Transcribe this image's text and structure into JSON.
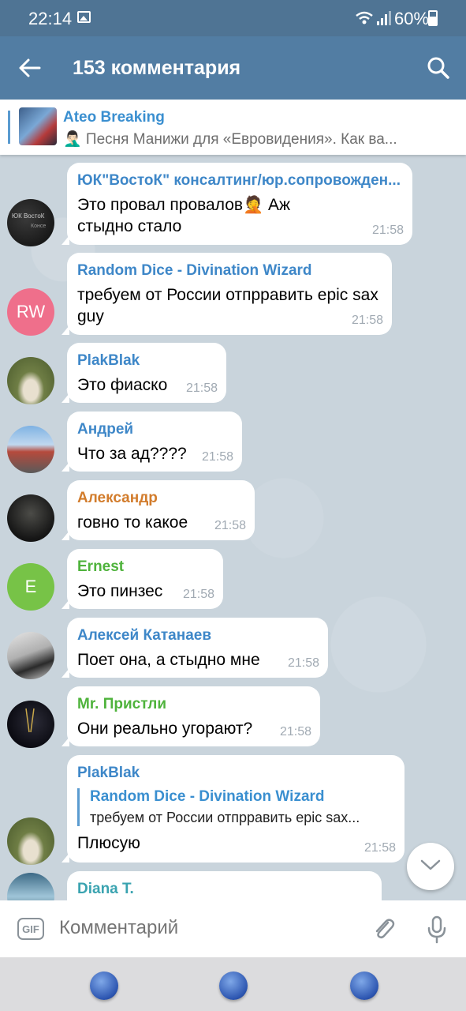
{
  "status_bar": {
    "time": "22:14",
    "battery": "60%"
  },
  "app_bar": {
    "title": "153 комментария"
  },
  "pinned": {
    "channel": "Ateo Breaking",
    "preview": "🤦🏻‍♂️ Песня Манижи для «Евровидения». Как ва..."
  },
  "messages": [
    {
      "author": "ЮК\"ВостоК\" консалтинг/юр.сопровожден...",
      "author_color": "#3e87c8",
      "text": "Это провал провалов🤦 Аж стыдно стало",
      "time": "21:58",
      "avatar": "photo-dark"
    },
    {
      "author": "Random Dice - Divination Wizard",
      "author_color": "#3e87c8",
      "text": "требуем от России отпрравить epic sax guy",
      "time": "21:58",
      "avatar_initials": "RW",
      "avatar_color": "#ef6f8b"
    },
    {
      "author": "PlakBlak",
      "author_color": "#3e87c8",
      "text": "Это фиаско",
      "time": "21:58",
      "avatar": "photo-duck"
    },
    {
      "author": "Андрей",
      "author_color": "#3e87c8",
      "text": "Что за ад????",
      "time": "21:58",
      "avatar": "photo-street"
    },
    {
      "author": "Александр",
      "author_color": "#d27c2c",
      "text": "говно то какое",
      "time": "21:58",
      "avatar": "photo-man"
    },
    {
      "author": "Ernest",
      "author_color": "#4fb33c",
      "text": "Это пинзес",
      "time": "21:58",
      "avatar_initials": "E",
      "avatar_color": "#77c347"
    },
    {
      "author": "Алексей Катанаев",
      "author_color": "#3e87c8",
      "text": "Поет она, а стыдно мне",
      "time": "21:58",
      "avatar": "photo-couple"
    },
    {
      "author": "Mr. Пристли",
      "author_color": "#4fb33c",
      "text": "Они реально угорают?",
      "time": "21:58",
      "avatar": "photo-dark-suit"
    },
    {
      "author": "PlakBlak",
      "author_color": "#3e87c8",
      "reply_author": "Random Dice - Divination Wizard",
      "reply_text": "требуем от России отпрравить epic sax...",
      "text": "Плюсую",
      "time": "21:58",
      "avatar": "photo-duck"
    },
    {
      "author": "Diana T.",
      "author_color": "#3aa3b0",
      "text": "",
      "time": "",
      "avatar": "photo-blue"
    }
  ],
  "composer": {
    "gif_label": "GIF",
    "placeholder": "Комментарий"
  }
}
